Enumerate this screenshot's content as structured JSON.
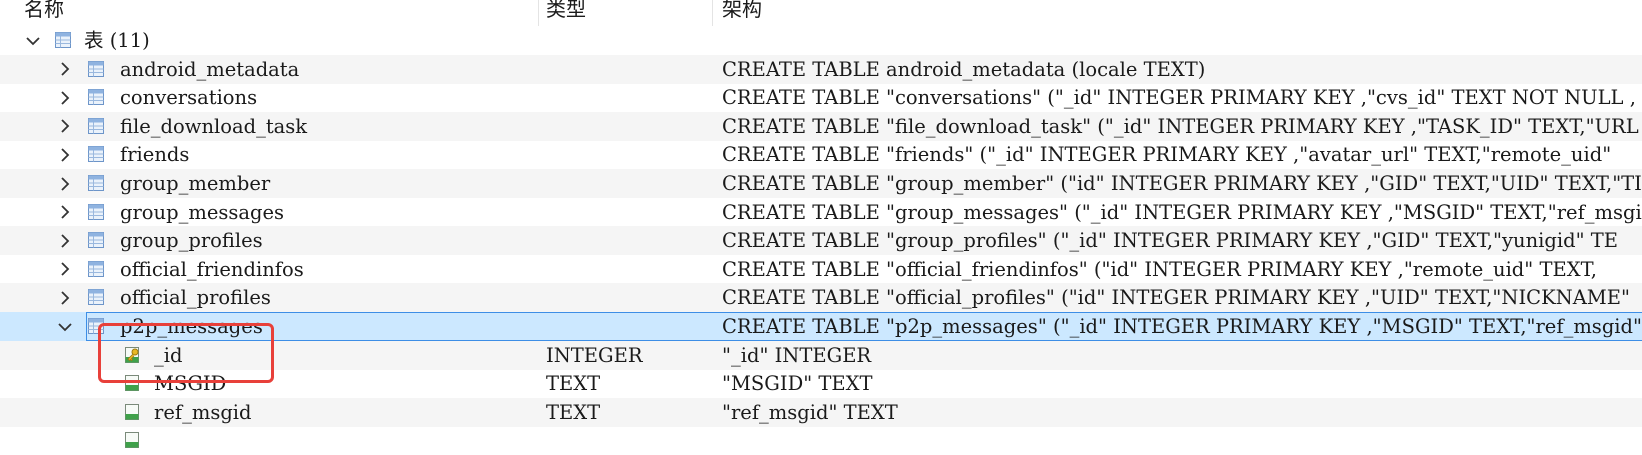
{
  "columns": {
    "name": "名称",
    "type": "类型",
    "schema": "架构"
  },
  "tree": {
    "root": {
      "label": "表 (11)"
    },
    "tables": [
      {
        "name": "android_metadata",
        "schema": "CREATE TABLE android_metadata (locale TEXT)"
      },
      {
        "name": "conversations",
        "schema": "CREATE TABLE \"conversations\" (\"_id\" INTEGER PRIMARY KEY ,\"cvs_id\" TEXT NOT NULL ,"
      },
      {
        "name": "file_download_task",
        "schema": "CREATE TABLE \"file_download_task\" (\"_id\" INTEGER PRIMARY KEY ,\"TASK_ID\" TEXT,\"URL"
      },
      {
        "name": "friends",
        "schema": "CREATE TABLE \"friends\" (\"_id\" INTEGER PRIMARY KEY ,\"avatar_url\" TEXT,\"remote_uid\""
      },
      {
        "name": "group_member",
        "schema": "CREATE TABLE \"group_member\" (\"id\" INTEGER PRIMARY KEY ,\"GID\" TEXT,\"UID\" TEXT,\"TIT"
      },
      {
        "name": "group_messages",
        "schema": "CREATE TABLE \"group_messages\" (\"_id\" INTEGER PRIMARY KEY ,\"MSGID\" TEXT,\"ref_msgid"
      },
      {
        "name": "group_profiles",
        "schema": "CREATE TABLE \"group_profiles\" (\"_id\" INTEGER PRIMARY KEY ,\"GID\" TEXT,\"yunigid\" TE"
      },
      {
        "name": "official_friendinfos",
        "schema": "CREATE TABLE \"official_friendinfos\" (\"id\" INTEGER PRIMARY KEY ,\"remote_uid\" TEXT,"
      },
      {
        "name": "official_profiles",
        "schema": "CREATE TABLE \"official_profiles\" (\"id\" INTEGER PRIMARY KEY ,\"UID\" TEXT,\"NICKNAME\""
      },
      {
        "name": "p2p_messages",
        "schema": "CREATE TABLE \"p2p_messages\" (\"_id\" INTEGER PRIMARY KEY ,\"MSGID\" TEXT,\"ref_msgid\""
      }
    ],
    "fields": [
      {
        "name": "_id",
        "type": "INTEGER",
        "schema": "\"_id\" INTEGER",
        "icon": "primary-key-column-icon"
      },
      {
        "name": "MSGID",
        "type": "TEXT",
        "schema": "\"MSGID\" TEXT",
        "icon": "column-icon"
      },
      {
        "name": "ref_msgid",
        "type": "TEXT",
        "schema": "\"ref_msgid\" TEXT",
        "icon": "column-icon"
      },
      {
        "name": "",
        "type": "",
        "schema": "",
        "icon": "column-icon"
      }
    ]
  },
  "colors": {
    "selection": "#cce8ff",
    "selection_border": "#3d8ee6",
    "highlight_box": "#e8403a",
    "alt_row": "#f5f5f5"
  }
}
